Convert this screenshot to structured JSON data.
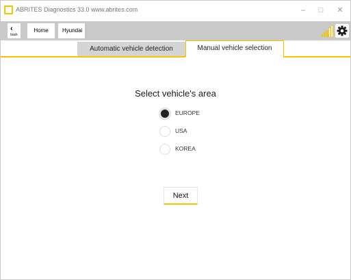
{
  "window": {
    "title": "ABRITES Diagnostics 33.0  www.abrites.com",
    "minimize": "–",
    "maximize": "□",
    "close": "✕"
  },
  "toolbar": {
    "back_label": "back",
    "back_icon": "chevron-left-icon",
    "breadcrumbs": [
      "Home",
      "Hyundai"
    ],
    "signal_icon": "signal-strength-icon",
    "settings_icon": "gear-icon"
  },
  "tabs": [
    {
      "label": "Automatic vehicle detection",
      "active": false
    },
    {
      "label": "Manual vehicle selection",
      "active": true
    }
  ],
  "content": {
    "title": "Select vehicle's area",
    "options": [
      {
        "label": "EUROPE",
        "selected": true
      },
      {
        "label": "USA",
        "selected": false
      },
      {
        "label": "KOREA",
        "selected": false
      }
    ],
    "next_label": "Next"
  },
  "colors": {
    "accent": "#f5c400",
    "toolbar_bg": "#c9c9c9",
    "tab_inactive_bg": "#d4d4d4"
  }
}
